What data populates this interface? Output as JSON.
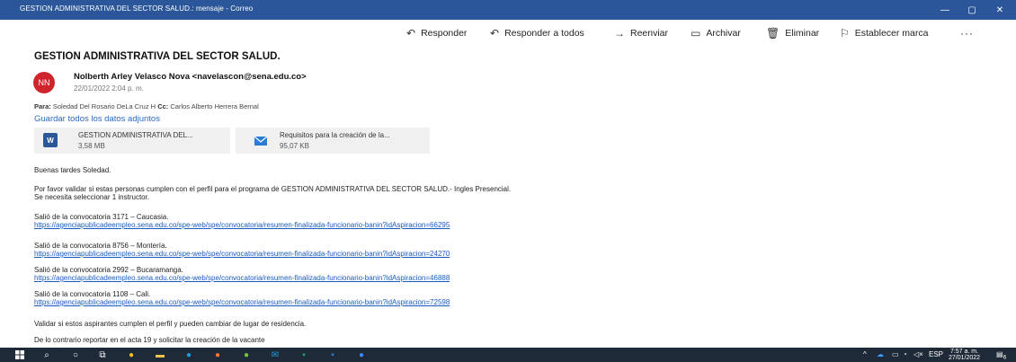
{
  "window": {
    "title": "GESTION ADMINISTRATIVA DEL SECTOR SALUD.: mensaje - Correo",
    "min_glyph": "—",
    "max_glyph": "▢",
    "close_glyph": "✕"
  },
  "toolbar": {
    "reply": "Responder",
    "reply_all": "Responder a todos",
    "forward": "Reenviar",
    "archive": "Archivar",
    "delete": "Eliminar",
    "flag": "Establecer marca",
    "more": "···"
  },
  "message": {
    "subject": "GESTION ADMINISTRATIVA DEL SECTOR SALUD.",
    "avatar_initials": "NN",
    "sender": "Nolberth Arley Velasco Nova <navelascon@sena.edu.co>",
    "date": "22/01/2022 2:04 p. m.",
    "to_label": "Para:",
    "to": "Soledad Del Rosario DeLa Cruz H",
    "cc_label": "Cc:",
    "cc": "Carlos Alberto Herrera Bernal",
    "save_all": "Guardar todos los datos adjuntos"
  },
  "attachments": [
    {
      "name": "GESTION ADMINISTRATIVA DEL...",
      "size": "3,58 MB",
      "icon": "word-icon"
    },
    {
      "name": "Requisitos para la creación de la...",
      "size": "95,07 KB",
      "icon": "envelope-icon"
    }
  ],
  "body": {
    "greeting": "Buenas tardes Soledad.",
    "para1_line1": "Por favor validar si estas personas cumplen con el perfil para el programa de GESTION ADMINISTRATIVA DEL SECTOR SALUD.- Ingles Presencial.",
    "para1_line2": "Se necesita seleccionar 1 instructor.",
    "items": [
      {
        "text": "Salió de la convocatoria  3171 – Caucasia.",
        "link": "https://agenciapublicadeempleo.sena.edu.co/spe-web/spe/convocatoria/resumen-finalizada-funcionario-banin?idAspiracion=66295"
      },
      {
        "text": "Salió de la convocatoria  8756 – Montería.",
        "link": "https://agenciapublicadeempleo.sena.edu.co/spe-web/spe/convocatoria/resumen-finalizada-funcionario-banin?idAspiracion=24270"
      },
      {
        "text": "Salió de la convocatoria  2992 – Bucaramanga.",
        "link": "https://agenciapublicadeempleo.sena.edu.co/spe-web/spe/convocatoria/resumen-finalizada-funcionario-banin?idAspiracion=46888"
      },
      {
        "text": "Salió de la convocatoria  1108 – Cali.",
        "link": "https://agenciapublicadeempleo.sena.edu.co/spe-web/spe/convocatoria/resumen-finalizada-funcionario-banin?idAspiracion=72598"
      }
    ],
    "validate": "Validar si estos aspirantes cumplen el perfil y pueden cambiar de lugar de residencia.",
    "otherwise": "De lo contrario reportar en el acta 19 y solicitar la creación de la vacante"
  },
  "taskbar": {
    "language": "ESP",
    "time": "7:57 a. m.",
    "date": "27/01/2022",
    "notification_count": "6"
  },
  "colors": {
    "titlebar": "#2b579a",
    "avatar": "#d0242c",
    "link": "#1a5bc4",
    "taskbar": "#1f2a38"
  }
}
